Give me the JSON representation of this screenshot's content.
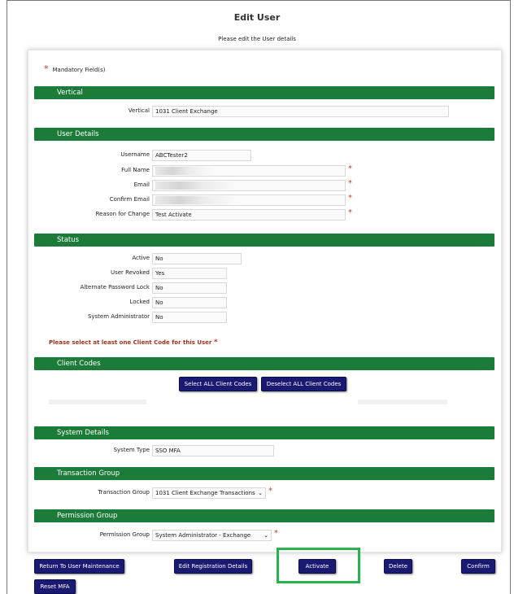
{
  "page": {
    "title": "Edit User",
    "subtitle": "Please edit the User details",
    "mandatory_label": "Mandatory Field(s)",
    "mandatory_star": "*"
  },
  "sections": {
    "vertical": "Vertical",
    "user_details": "User Details",
    "status": "Status",
    "client_codes": "Client Codes",
    "system_details": "System Details",
    "transaction_group": "Transaction Group",
    "permission_group": "Permission Group"
  },
  "vertical": {
    "label": "Vertical",
    "value": "1031 Client Exchange"
  },
  "user_details": {
    "username": {
      "label": "Username",
      "value": "ABCTester2"
    },
    "full_name": {
      "label": "Full Name",
      "value": ""
    },
    "email": {
      "label": "Email",
      "value": ""
    },
    "confirm_email": {
      "label": "Confirm Email",
      "value": ""
    },
    "reason": {
      "label": "Reason for Change",
      "value": "Test Activate"
    }
  },
  "status": {
    "active": {
      "label": "Active",
      "value": "No"
    },
    "revoked": {
      "label": "User Revoked",
      "value": "Yes"
    },
    "alt_lock": {
      "label": "Alternate Password Lock",
      "value": "No"
    },
    "locked": {
      "label": "Locked",
      "value": "No"
    },
    "sysadmin": {
      "label": "System Administrator",
      "value": "No"
    }
  },
  "client_codes": {
    "warning": "Please select at least one Client Code for this User",
    "select_all": "Select ALL Client Codes",
    "deselect_all": "Deselect ALL Client Codes"
  },
  "system_details": {
    "label": "System Type",
    "value": "SSO MFA"
  },
  "transaction_group": {
    "label": "Transaction Group",
    "value": "1031 Client Exchange Transactions"
  },
  "permission_group": {
    "label": "Permission Group",
    "value": "System Administrator - Exchange"
  },
  "actions": {
    "return": "Return To User Maintenance",
    "edit_registration": "Edit Registration Details",
    "activate": "Activate",
    "delete": "Delete",
    "confirm": "Confirm",
    "reset_mfa": "Reset MFA"
  },
  "colors": {
    "section_bar": "#1d7b3a",
    "button": "#1a1a72",
    "required": "#c0392b",
    "highlight": "#27b34b"
  }
}
